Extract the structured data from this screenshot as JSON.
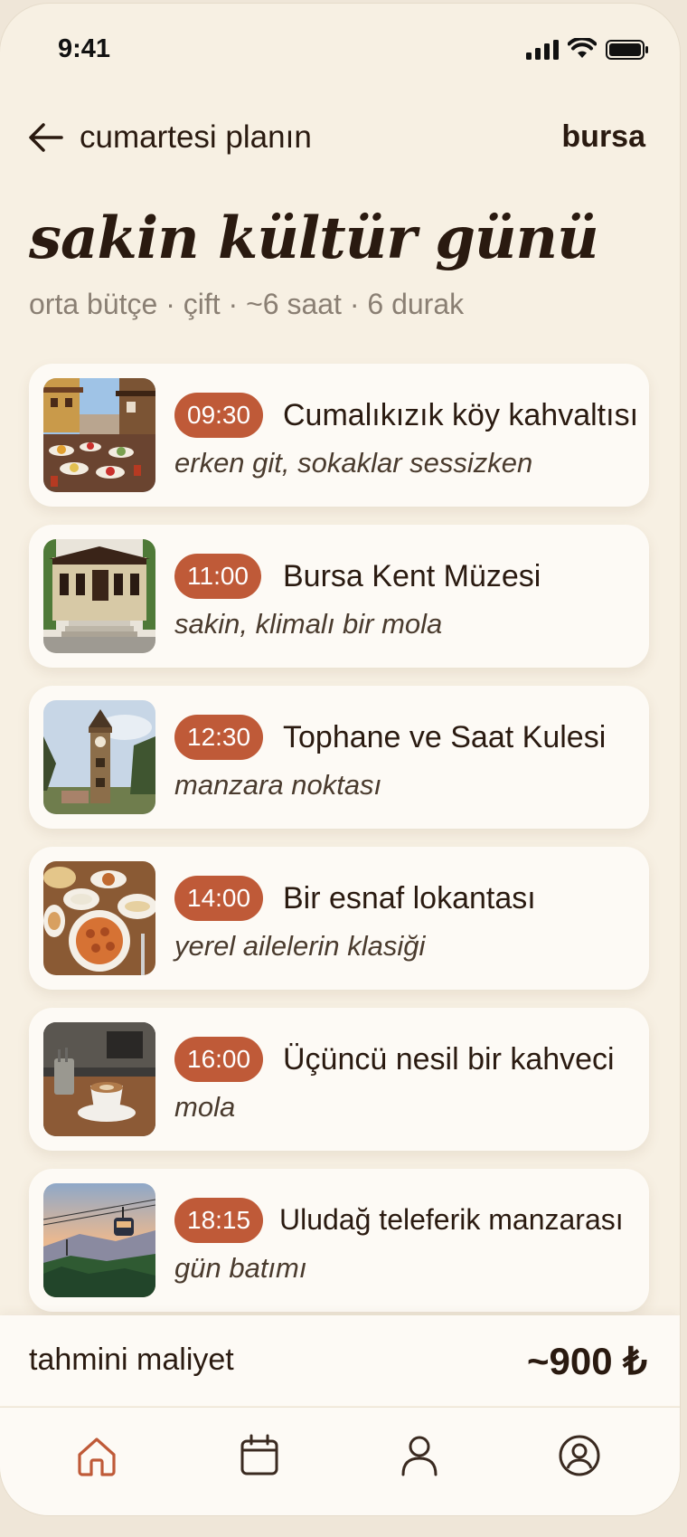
{
  "status": {
    "time": "9:41"
  },
  "nav": {
    "title": "cumartesi planın",
    "city": "bursa"
  },
  "headline": "sakin kültür günü",
  "meta": "orta bütçe · çift · ~6 saat · 6 durak",
  "stops": [
    {
      "time": "09:30",
      "title": "Cumalıkızık köy kahvaltısı",
      "note": "erken git, sokaklar sessizken",
      "image": "village-breakfast"
    },
    {
      "time": "11:00",
      "title": "Bursa Kent Müzesi",
      "note": "sakin, klimalı bir mola",
      "image": "city-museum"
    },
    {
      "time": "12:30",
      "title": "Tophane ve Saat Kulesi",
      "note": "manzara noktası",
      "image": "clock-tower"
    },
    {
      "time": "14:00",
      "title": "Bir esnaf lokantası",
      "note": "yerel ailelerin klasiği",
      "image": "local-food"
    },
    {
      "time": "16:00",
      "title": "Üçüncü nesil bir kahveci",
      "note": "mola",
      "image": "coffee-cup"
    },
    {
      "time": "18:15",
      "title": "Uludağ teleferik manzarası",
      "note": "gün batımı",
      "image": "cable-car-sunset"
    }
  ],
  "cost": {
    "label": "tahmini maliyet",
    "value": "~900 ₺"
  },
  "tabs": [
    "home-icon",
    "calendar-icon",
    "profile-icon",
    "account-icon"
  ],
  "colors": {
    "accent": "#bf5a38",
    "background": "#f7f0e3",
    "text": "#2a1a10"
  }
}
